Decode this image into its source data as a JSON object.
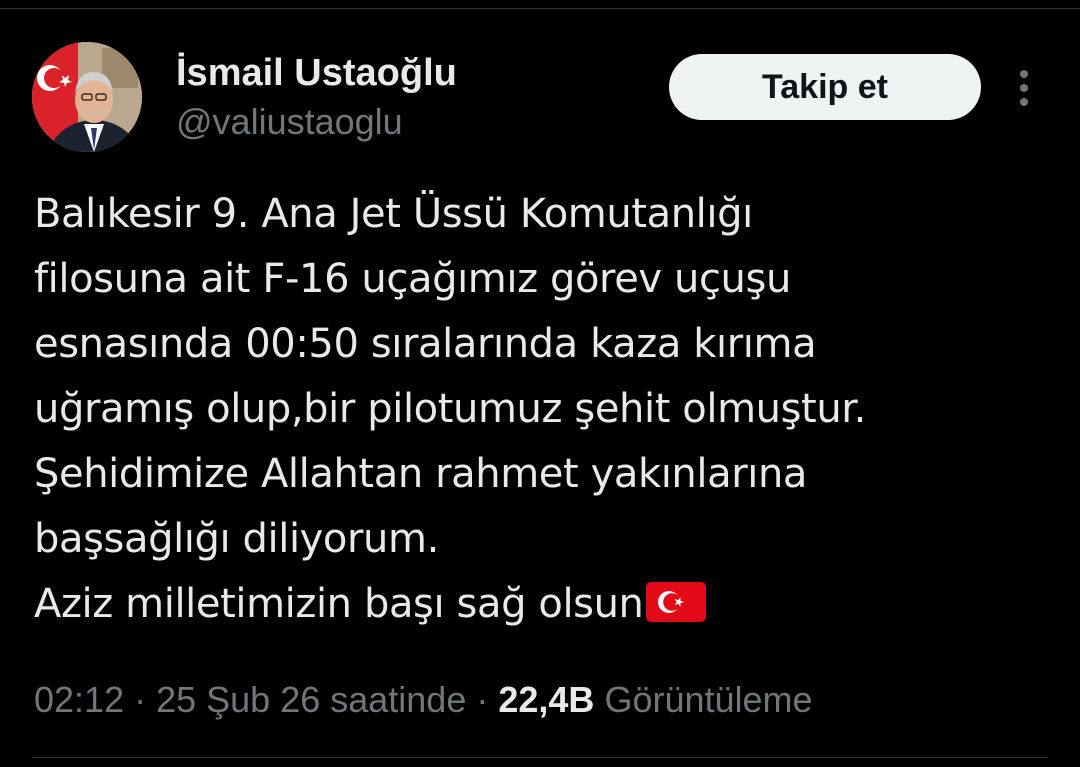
{
  "author": {
    "name": "İsmail Ustaoğlu",
    "handle": "@valiustaoglu"
  },
  "follow_button": {
    "label": "Takip et"
  },
  "more_menu": {
    "icon": "more-vertical-icon"
  },
  "tweet": {
    "lines": [
      "Balıkesir 9. Ana Jet Üssü Komutanlığı",
      "filosuna ait F-16 uçağımız görev uçuşu",
      "esnasında 00:50 sıralarında kaza kırıma",
      "uğramış olup,bir pilotumuz şehit olmuştur.",
      "Şehidimize Allahtan rahmet yakınlarına",
      "başsağlığı diliyorum.",
      "Aziz milletimizin başı sağ olsun"
    ],
    "trailing_emoji": "turkey-flag-emoji"
  },
  "meta": {
    "time": "02:12",
    "separator": " · ",
    "date": "25 Şub 26 saatinde",
    "views_count": "22,4B",
    "views_label": "Görüntüleme"
  },
  "colors": {
    "background": "#000000",
    "text": "#e7e9ea",
    "secondary": "#71767b",
    "button_bg": "#eff3f4",
    "button_text": "#0f1419",
    "flag_red": "#e30a17"
  }
}
